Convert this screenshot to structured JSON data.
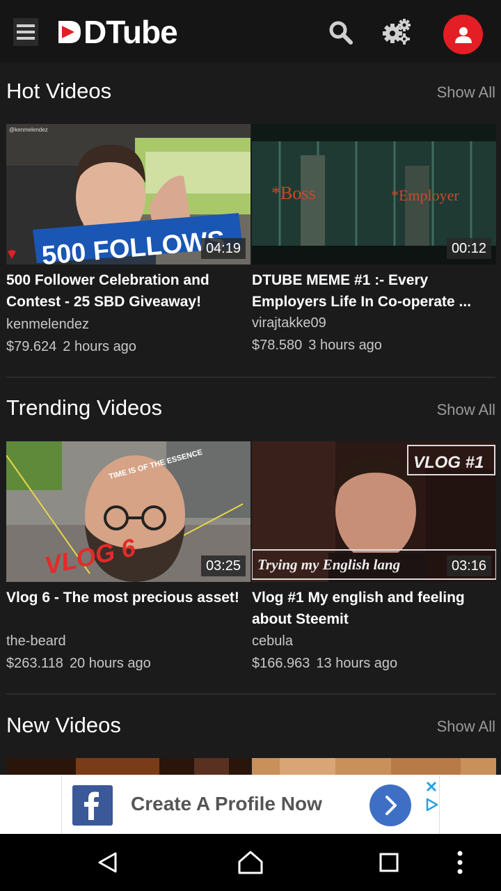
{
  "app": {
    "logo_text": "DTube"
  },
  "sections": [
    {
      "title": "Hot Videos",
      "show_all": "Show All",
      "videos": [
        {
          "thumb_text": "500 FOLLOWS",
          "thumb_corner": "@kenmelendez",
          "duration": "04:19",
          "title": "500 Follower Celebration and Contest - 25 SBD Giveaway!",
          "author": "kenmelendez",
          "payout": "$79.624",
          "age": "2 hours ago"
        },
        {
          "thumb_text": "",
          "thumb_label_left": "*Boss",
          "thumb_label_right": "*Employer",
          "duration": "00:12",
          "title": "DTUBE MEME #1 :- Every Employers Life In Co-operate ...",
          "author": "virajtakke09",
          "payout": "$78.580",
          "age": "3 hours ago"
        }
      ]
    },
    {
      "title": "Trending Videos",
      "show_all": "Show All",
      "videos": [
        {
          "thumb_text": "VLOG 6",
          "thumb_forehead": "TIME IS OF THE ESSENCE",
          "duration": "03:25",
          "title": "Vlog 6 - The most precious asset!",
          "author": "the-beard",
          "payout": "$263.118",
          "age": "20 hours ago"
        },
        {
          "thumb_text": "VLOG #1",
          "thumb_caption": "Trying my English lang",
          "duration": "03:16",
          "title": "Vlog #1 My english and feeling about Steemit",
          "author": "cebula",
          "payout": "$166.963",
          "age": "13 hours ago"
        }
      ]
    },
    {
      "title": "New Videos",
      "show_all": "Show All"
    }
  ],
  "ad": {
    "text": "Create A Profile Now"
  },
  "colors": {
    "brand_red": "#e31e24",
    "facebook_blue": "#3b5998",
    "ad_arrow_blue": "#3e6fc4"
  },
  "icons": {
    "menu": "hamburger-icon",
    "search": "search-icon",
    "settings": "gear-icon",
    "profile": "user-icon"
  }
}
